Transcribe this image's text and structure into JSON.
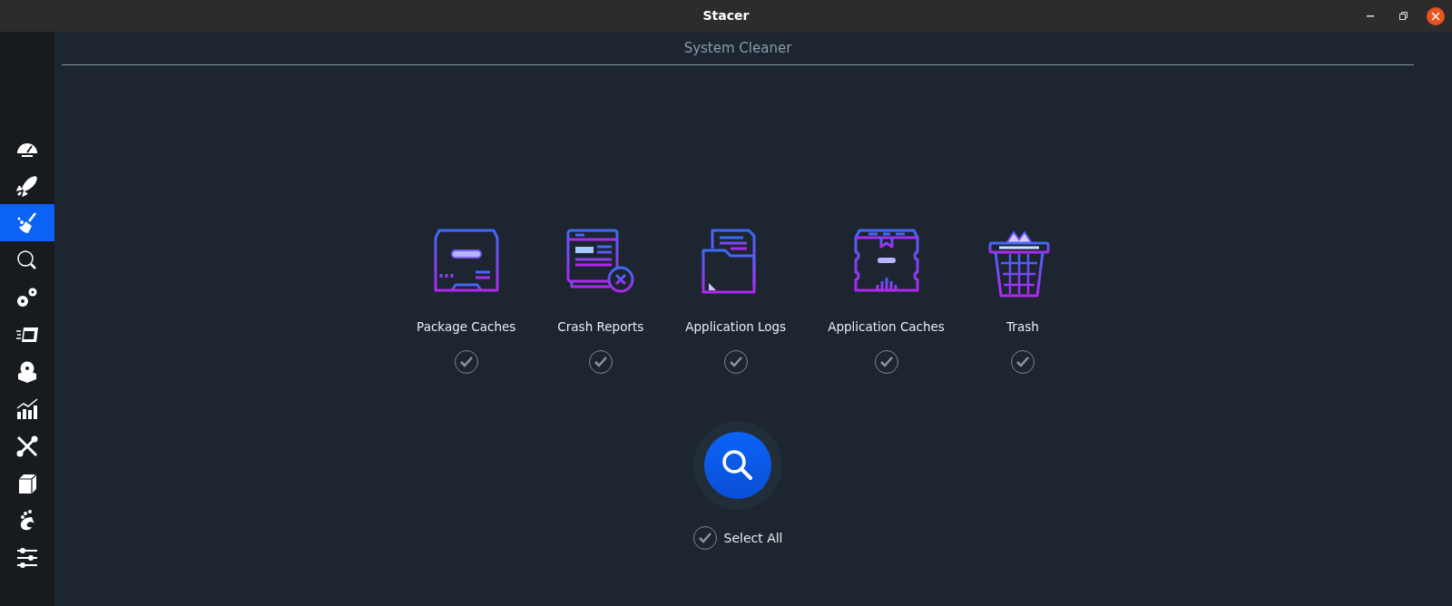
{
  "window": {
    "title": "Stacer"
  },
  "sidebar": {
    "items": [
      {
        "kind": "dashboard",
        "selected": false
      },
      {
        "kind": "startup",
        "selected": false
      },
      {
        "kind": "cleaner",
        "selected": true
      },
      {
        "kind": "search",
        "selected": false
      },
      {
        "kind": "services",
        "selected": false
      },
      {
        "kind": "processes",
        "selected": false
      },
      {
        "kind": "uninstaller",
        "selected": false
      },
      {
        "kind": "resources",
        "selected": false
      },
      {
        "kind": "tools",
        "selected": false
      },
      {
        "kind": "packages",
        "selected": false
      },
      {
        "kind": "gnome",
        "selected": false
      },
      {
        "kind": "settings",
        "selected": false
      }
    ]
  },
  "page": {
    "title": "System Cleaner",
    "categories": [
      {
        "kind": "package",
        "label": "Package Caches",
        "checked": true
      },
      {
        "kind": "crash",
        "label": "Crash Reports",
        "checked": true
      },
      {
        "kind": "logs",
        "label": "Application Logs",
        "checked": true
      },
      {
        "kind": "cache",
        "label": "Application Caches",
        "checked": true
      },
      {
        "kind": "trash",
        "label": "Trash",
        "checked": true
      }
    ],
    "select_all": {
      "label": "Select All",
      "checked": true
    }
  }
}
